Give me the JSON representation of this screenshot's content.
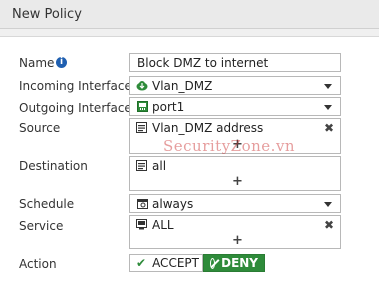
{
  "window": {
    "title": "New Policy"
  },
  "form": {
    "name": {
      "label": "Name",
      "value": "Block DMZ to internet"
    },
    "incoming": {
      "label": "Incoming Interface",
      "value": "Vlan_DMZ"
    },
    "outgoing": {
      "label": "Outgoing Interface",
      "value": "port1"
    },
    "source": {
      "label": "Source",
      "value": "Vlan_DMZ address",
      "add": "+"
    },
    "destination": {
      "label": "Destination",
      "value": "all",
      "add": "+"
    },
    "schedule": {
      "label": "Schedule",
      "value": "always"
    },
    "service": {
      "label": "Service",
      "value": "ALL",
      "add": "+"
    },
    "action": {
      "label": "Action",
      "accept": "ACCEPT",
      "deny": "DENY",
      "selected": "DENY"
    }
  },
  "watermark": "SecurityZone.vn",
  "colors": {
    "deny_green": "#2e8b3a",
    "info_blue": "#1f5fb0",
    "accept_check": "#2e8b3a"
  }
}
